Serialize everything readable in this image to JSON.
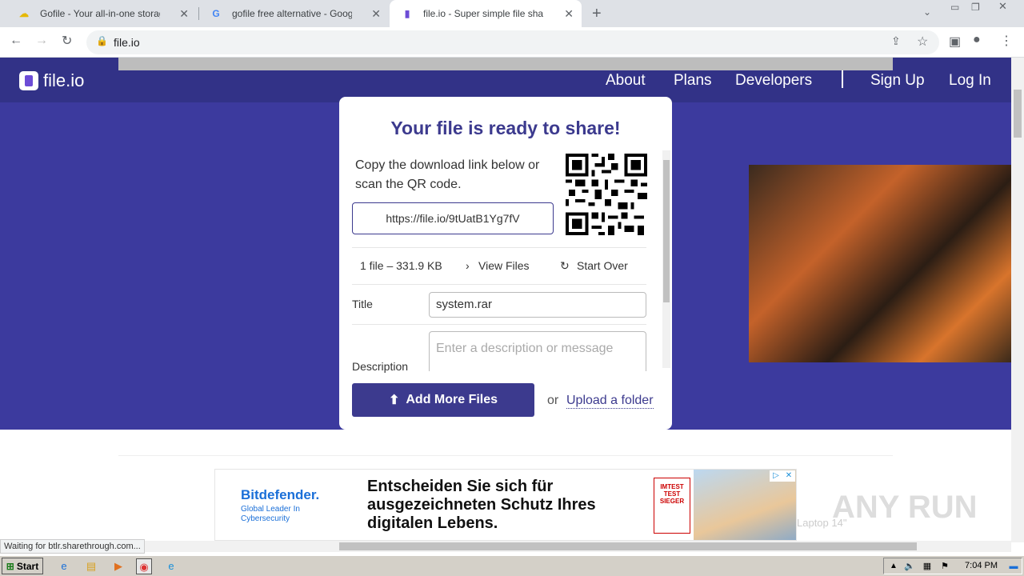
{
  "browser": {
    "tabs": [
      {
        "title": "Gofile - Your all-in-one storage soluti",
        "icon": "gofile-favicon"
      },
      {
        "title": "gofile free alternative - Google Such",
        "icon": "google-favicon"
      },
      {
        "title": "file.io - Super simple file sharing",
        "icon": "fileio-favicon",
        "active": true
      }
    ],
    "new_tab": "+",
    "address": "file.io",
    "status": "Waiting for btlr.sharethrough.com..."
  },
  "site": {
    "logo": "file.io",
    "nav": [
      "About",
      "Plans",
      "Developers",
      "Sign Up",
      "Log In"
    ]
  },
  "card": {
    "title": "Your file is ready to share!",
    "instructions": "Copy the download link below or scan the QR code.",
    "link": "https://file.io/9tUatB1Yg7fV",
    "file_summary": "1 file – 331.9 KB",
    "view_files": "View Files",
    "start_over": "Start Over",
    "title_label": "Title",
    "title_value": "system.rar",
    "description_label": "Description",
    "description_placeholder": "Enter a description or message",
    "add_more": "Add More Files",
    "or": "or",
    "upload_folder": "Upload a folder"
  },
  "ad": {
    "brand": "Bitdefender.",
    "tagline": "Global Leader In Cybersecurity",
    "headline": "Entscheiden Sie sich für ausgezeichneten Schutz Ihres digitalen Lebens.",
    "badge": "IMTEST TEST SIEGER"
  },
  "watermark": "ANY RUN",
  "ghost_text": "Laptop 14\"",
  "taskbar": {
    "start": "Start",
    "clock": "7:04 PM"
  },
  "colors": {
    "hero": "#3c3a9e",
    "nav": "#323287",
    "accent": "#3c3a8e"
  }
}
